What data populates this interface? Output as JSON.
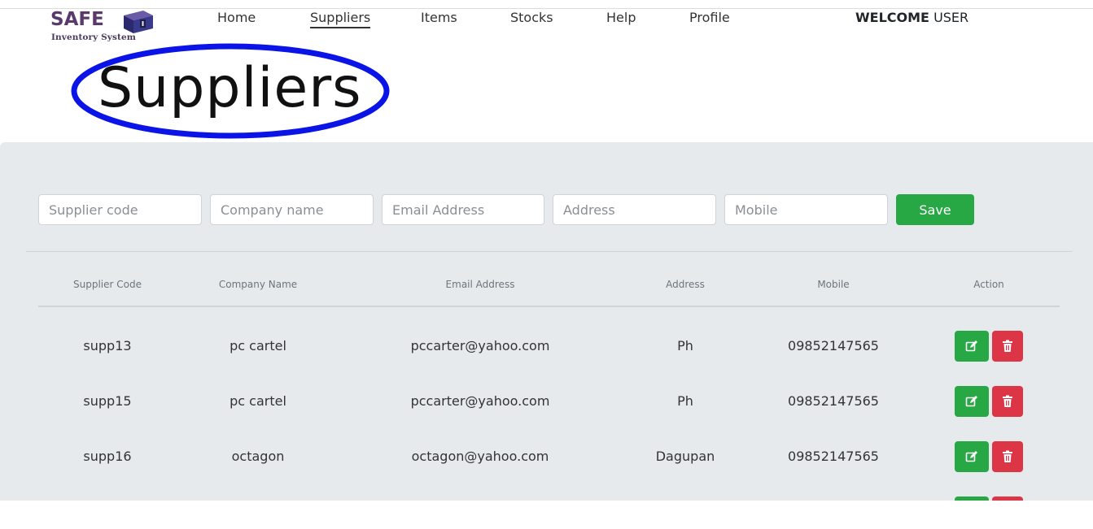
{
  "brand": {
    "name": "SAFE",
    "subtitle": "Inventory System"
  },
  "nav": {
    "items": [
      {
        "label": "Home",
        "active": false
      },
      {
        "label": "Suppliers",
        "active": true
      },
      {
        "label": "Items",
        "active": false
      },
      {
        "label": "Stocks",
        "active": false
      },
      {
        "label": "Help",
        "active": false
      },
      {
        "label": "Profile",
        "active": false
      }
    ],
    "welcome_bold": "WELCOME",
    "welcome_user": "USER"
  },
  "page": {
    "title": "Suppliers"
  },
  "form": {
    "placeholders": [
      "Supplier code",
      "Company name",
      "Email Address",
      "Address",
      "Mobile"
    ],
    "save_label": "Save"
  },
  "table": {
    "headers": [
      "Supplier Code",
      "Company Name",
      "Email Address",
      "Address",
      "Mobile",
      "Action"
    ],
    "rows": [
      {
        "code": "supp13",
        "company": "pc cartel",
        "email": "pccarter@yahoo.com",
        "address": "Ph",
        "mobile": "09852147565"
      },
      {
        "code": "supp15",
        "company": "pc cartel",
        "email": "pccarter@yahoo.com",
        "address": "Ph",
        "mobile": "09852147565"
      },
      {
        "code": "supp16",
        "company": "octagon",
        "email": "octagon@yahoo.com",
        "address": "Dagupan",
        "mobile": "09852147565"
      }
    ],
    "action_icons": [
      "edit-icon",
      "trash-icon"
    ]
  },
  "colors": {
    "accent_green": "#28a745",
    "danger_red": "#dc3545",
    "panel_bg": "#e7eaed",
    "title_highlight": "#0a14e6",
    "brand_purple": "#5a3a6a"
  }
}
